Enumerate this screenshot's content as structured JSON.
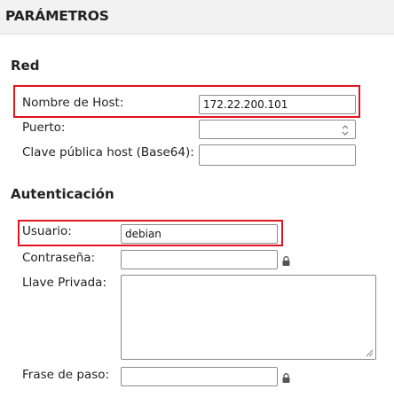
{
  "header": {
    "title": "PARÁMETROS"
  },
  "network": {
    "section_title": "Red",
    "hostname_label": "Nombre de Host:",
    "hostname_value": "172.22.200.101",
    "port_label": "Puerto:",
    "port_value": "",
    "hostkey_label": "Clave pública host (Base64):",
    "hostkey_value": ""
  },
  "auth": {
    "section_title": "Autenticación",
    "username_label": "Usuario:",
    "username_value": "debian",
    "password_label": "Contraseña:",
    "password_value": "",
    "private_key_label": "Llave Privada:",
    "private_key_value": "",
    "passphrase_label": "Frase de paso:",
    "passphrase_value": ""
  },
  "colors": {
    "highlight": "#e0141e",
    "header_bg": "#f2f2f2"
  },
  "icons": {
    "password_lock": "lock-icon",
    "passphrase_lock": "lock-icon",
    "port_spinner": "spinner-icon"
  }
}
